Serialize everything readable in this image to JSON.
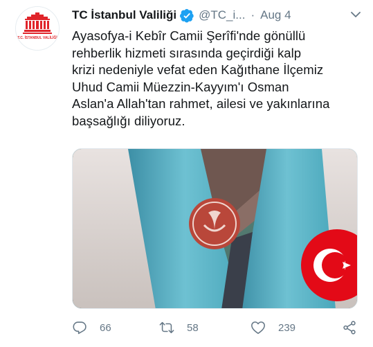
{
  "tweet": {
    "author_name": "TC İstanbul Valiliği",
    "handle": "@TC_i...",
    "separator": "·",
    "date": "Aug 4",
    "avatar_text": "T.C. İSTANBUL VALİLİĞİ",
    "text_lines": [
      "Ayasofya-i Kebîr Camii Şerîfi'nde gönüllü",
      "rehberlik hizmeti sırasında geçirdiği kalp",
      "krizi nedeniyle vefat eden Kağıthane İlçemiz",
      "Uhud Camii Müezzin-Kayyım'ı Osman",
      "Aslan'a Allah'tan rahmet, ailesi ve yakınlarına",
      "başsağlığı diliyoruz."
    ],
    "actions": {
      "reply_count": "66",
      "retweet_count": "58",
      "like_count": "239"
    }
  },
  "colors": {
    "text": "#14171a",
    "muted": "#657786",
    "verified": "#1da1f2",
    "logo_red": "#e0242a",
    "vest_blue": "#5fb6c7",
    "flag_red": "#e30a17"
  },
  "icons": [
    "verified-badge-icon",
    "chevron-down-icon",
    "reply-icon",
    "retweet-icon",
    "like-icon",
    "share-icon"
  ]
}
